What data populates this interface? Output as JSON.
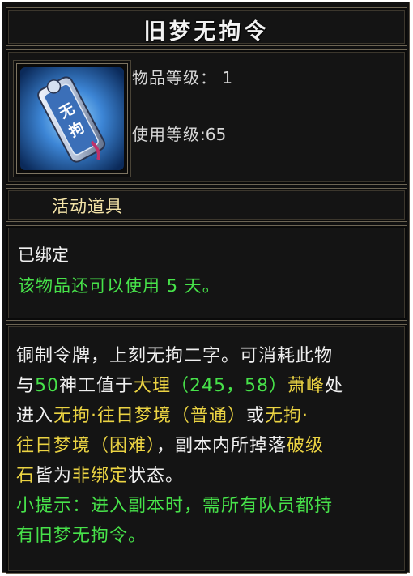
{
  "item": {
    "name": "旧梦无拘令",
    "icon": "token-tablet-icon",
    "item_level_label": "物品等级：",
    "item_level_value": "1",
    "use_level_label": "使用等级",
    "use_level_value": ":65",
    "category": "活动道具",
    "bound_status": "已绑定",
    "remaining_prefix": "该物品还可以使用",
    "remaining_days": "5",
    "remaining_suffix": "天。"
  },
  "description": {
    "l1": "铜制令牌，上刻无拘二字。可消耗此物",
    "l2_a": "与",
    "l2_num": "50",
    "l2_b": "神工值于",
    "l2_place": "大理",
    "l2_coords": "（245，58）",
    "l2_npc": "萧峰",
    "l2_c": "处",
    "l3_a": "进入",
    "l3_dungeon1": "无拘·往日梦境（普通）",
    "l3_b": "或",
    "l3_dungeon2a": "无拘·",
    "l4_dungeon2b": "往日梦境（困难）",
    "l4_a": "，副本内所掉落",
    "l4_item": "破级",
    "l5_item": "石",
    "l5_a": "皆为",
    "l5_state": "非绑定",
    "l5_b": "状态。",
    "tip_l1": "小提示：进入副本时，需所有队员都持",
    "tip_l2": "有旧梦无拘令。"
  },
  "colors": {
    "title": "#f2f2f2",
    "category": "#f4e4a8",
    "highlight_yellow": "#ecd443",
    "highlight_green": "#47e24a",
    "text_white": "#f0f0f0",
    "border": "#6d6554"
  }
}
